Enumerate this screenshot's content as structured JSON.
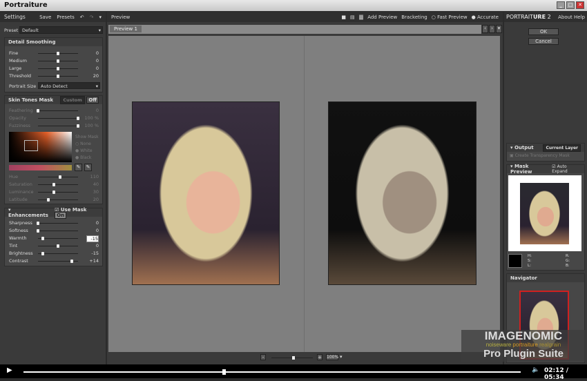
{
  "window": {
    "title": "Portraiture",
    "controls": [
      "_",
      "□",
      "✕"
    ]
  },
  "settings": {
    "title": "Settings",
    "save": "Save",
    "presets": "Presets",
    "undo_icon": "undo-icon",
    "redo_icon": "redo-icon",
    "preset_label": "Preset",
    "preset_value": "Default"
  },
  "detail_smoothing": {
    "title": "Detail Smoothing",
    "sliders": [
      {
        "label": "Fine",
        "value": "0",
        "pos": 0.5
      },
      {
        "label": "Medium",
        "value": "0",
        "pos": 0.5
      },
      {
        "label": "Large",
        "value": "0",
        "pos": 0.5
      },
      {
        "label": "Threshold",
        "value": "20",
        "pos": 0.5
      }
    ],
    "portrait_size_label": "Portrait Size",
    "portrait_size_value": "Auto Detect"
  },
  "skin_tones": {
    "title": "Skin Tones Mask",
    "mode": "Custom",
    "toggle": "Off",
    "sliders": [
      {
        "label": "Feathering",
        "value": "0",
        "pos": 0.0
      },
      {
        "label": "Opacity",
        "value": "100  %",
        "pos": 1.0
      },
      {
        "label": "Fuzziness",
        "value": "100  %",
        "pos": 1.0
      }
    ],
    "show_mask": "Show Mask",
    "mask_options": [
      "None",
      "White",
      "Black"
    ],
    "mask_selected": "None",
    "hsl": [
      {
        "label": "Hue",
        "value": "110",
        "pos": 0.55
      },
      {
        "label": "Saturation",
        "value": "40",
        "pos": 0.4
      },
      {
        "label": "Luminance",
        "value": "30",
        "pos": 0.4
      },
      {
        "label": "Latitude",
        "value": "20",
        "pos": 0.25
      }
    ]
  },
  "enhancements": {
    "title": "Enhancements",
    "use_mask": "Use Mask",
    "use_mask_checked": true,
    "toggle": "On",
    "sliders": [
      {
        "label": "Sharpness",
        "value": "0",
        "pos": 0.0
      },
      {
        "label": "Softness",
        "value": "0",
        "pos": 0.0
      },
      {
        "label": "Warmth",
        "value": "-15",
        "pos": 0.12,
        "editing": true
      },
      {
        "label": "Tint",
        "value": "0",
        "pos": 0.5
      },
      {
        "label": "Brightness",
        "value": "-15",
        "pos": 0.12
      },
      {
        "label": "Contrast",
        "value": "+14",
        "pos": 0.85
      }
    ]
  },
  "preview": {
    "title": "Preview",
    "layout_icons": [
      "single-view-icon",
      "split-horizontal-icon",
      "split-vertical-icon"
    ],
    "add_preview": "Add Preview",
    "bracketing": "Bracketing",
    "fast_preview": "Fast Preview",
    "accurate": "Accurate",
    "quality_selected": "Accurate",
    "tab": "Preview 1",
    "zoom": "100%",
    "zoom_pos": 0.5
  },
  "brand": {
    "name_light": "PORTRAIT",
    "name_bold": "URE",
    "version": "2",
    "about": "About",
    "help": "Help",
    "ok": "OK",
    "cancel": "Cancel"
  },
  "output": {
    "title": "Output",
    "target": "Current Layer",
    "create_mask": "Create Transparency Mask"
  },
  "mask_preview": {
    "title": "Mask Preview",
    "auto_expand": "Auto Expand",
    "hsl_labels": [
      "H:",
      "S:",
      "L:"
    ],
    "rgb_labels": [
      "R:",
      "G:",
      "B:"
    ]
  },
  "navigator": {
    "title": "Navigator"
  },
  "watermark": {
    "company": "IMAGENOMIC",
    "products": [
      "noiseware",
      "portraiture",
      "realgrain"
    ],
    "suite": "Pro Plugin Suite"
  },
  "player": {
    "current": "02:12",
    "total": "05:34",
    "time_text": "02:12 / 05:34",
    "progress": 0.4,
    "colors": {
      "accent": "#ff8a2a",
      "bg": "#000000"
    }
  }
}
